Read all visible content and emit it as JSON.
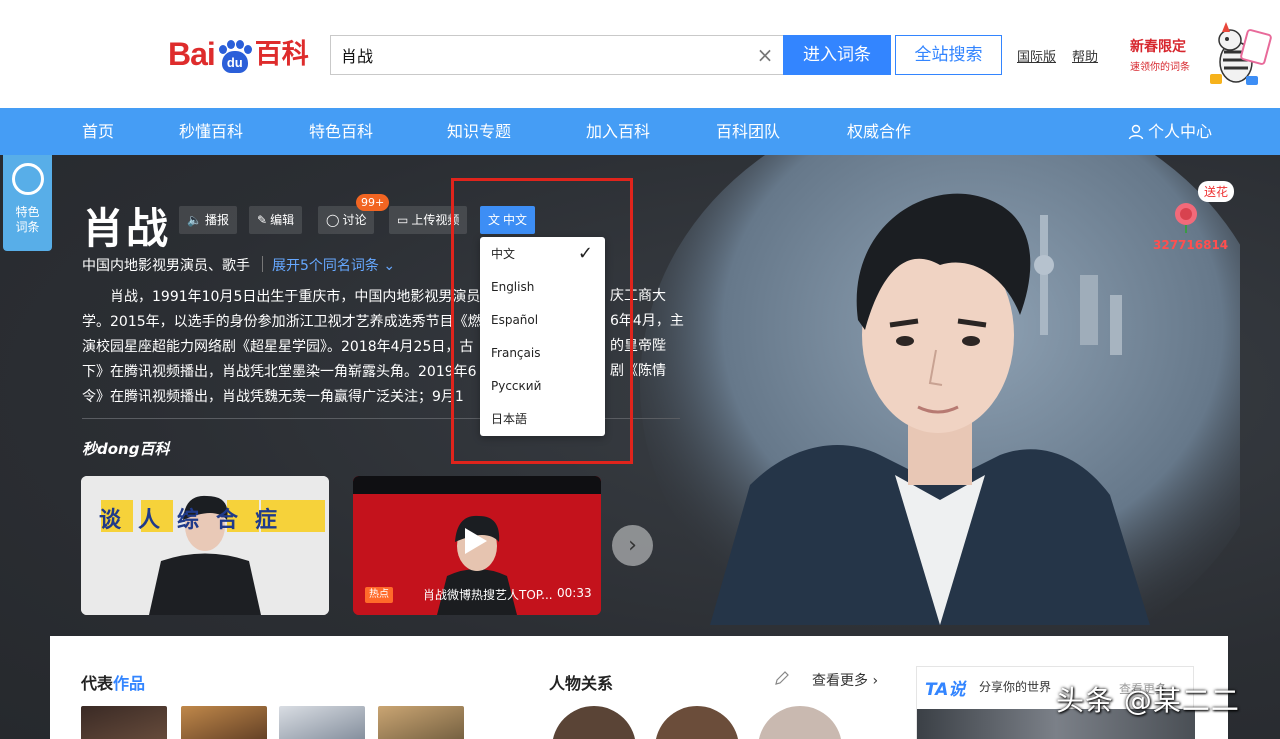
{
  "header": {
    "logo_bai": "Bai",
    "logo_du": "du",
    "logo_baike": "百科",
    "search_value": "肖战",
    "search_clear": "×",
    "btn_enter": "进入词条",
    "btn_site": "全站搜索",
    "link_intl": "国际版",
    "link_help": "帮助",
    "promo_title": "新春限定",
    "promo_sub": "速领你的词条"
  },
  "nav": {
    "items": [
      "首页",
      "秒懂百科",
      "特色百科",
      "知识专题",
      "加入百科",
      "百科团队",
      "权威合作"
    ],
    "user_center": "个人中心"
  },
  "hero": {
    "special_tag": "特色\n词条",
    "title": "肖战",
    "tools": {
      "play": "播报",
      "edit": "编辑",
      "discuss": "讨论",
      "discuss_badge": "99+",
      "upload": "上传视频",
      "lang": "中文"
    },
    "subtitle": "中国内地影视男演员、歌手",
    "expand": "展开5个同名词条",
    "summary_lines": [
      "肖战，1991年10月5日出生于重庆市，中国内地影视男演员",
      "学。2015年，以选手的身份参加浙江卫视才艺养成选秀节目《燃",
      "演校园星座超能力网络剧《超星星学园》。2018年4月25日，古",
      "下》在腾讯视频播出，肖战凭北堂墨染一角崭露头角。2019年6",
      "令》在腾讯视频播出，肖战凭魏无羡一角赢得广泛关注；9月1"
    ],
    "summary_right_fragments": [
      "庆工商大",
      "6年4月，主",
      "的皇帝陛",
      "剧《陈情"
    ],
    "miao_logo": "秒dong百科",
    "video1_title": "谈人综合症",
    "video2_hot": "热点",
    "video2_caption": "肖战微博热搜艺人TOP...",
    "video2_duration": "00:33",
    "flower_bubble": "送花",
    "flower_count": "327716814"
  },
  "lang_dropdown": {
    "options": [
      "中文",
      "English",
      "Español",
      "Français",
      "Русский",
      "日本語"
    ],
    "selected": "中文"
  },
  "panel": {
    "works_title_a": "代表",
    "works_title_b": "作品",
    "relations_title": "人物关系",
    "see_more": "查看更多",
    "ta_logo": "TA说",
    "ta_slogan": "分享你的世界",
    "ta_more": "查看更多"
  },
  "watermark": "头条 @某二二",
  "colors": {
    "nav_blue": "#459df5",
    "brand_blue": "#3385ff",
    "brand_red": "#de2c2c",
    "highlight_red": "#e0241c"
  }
}
